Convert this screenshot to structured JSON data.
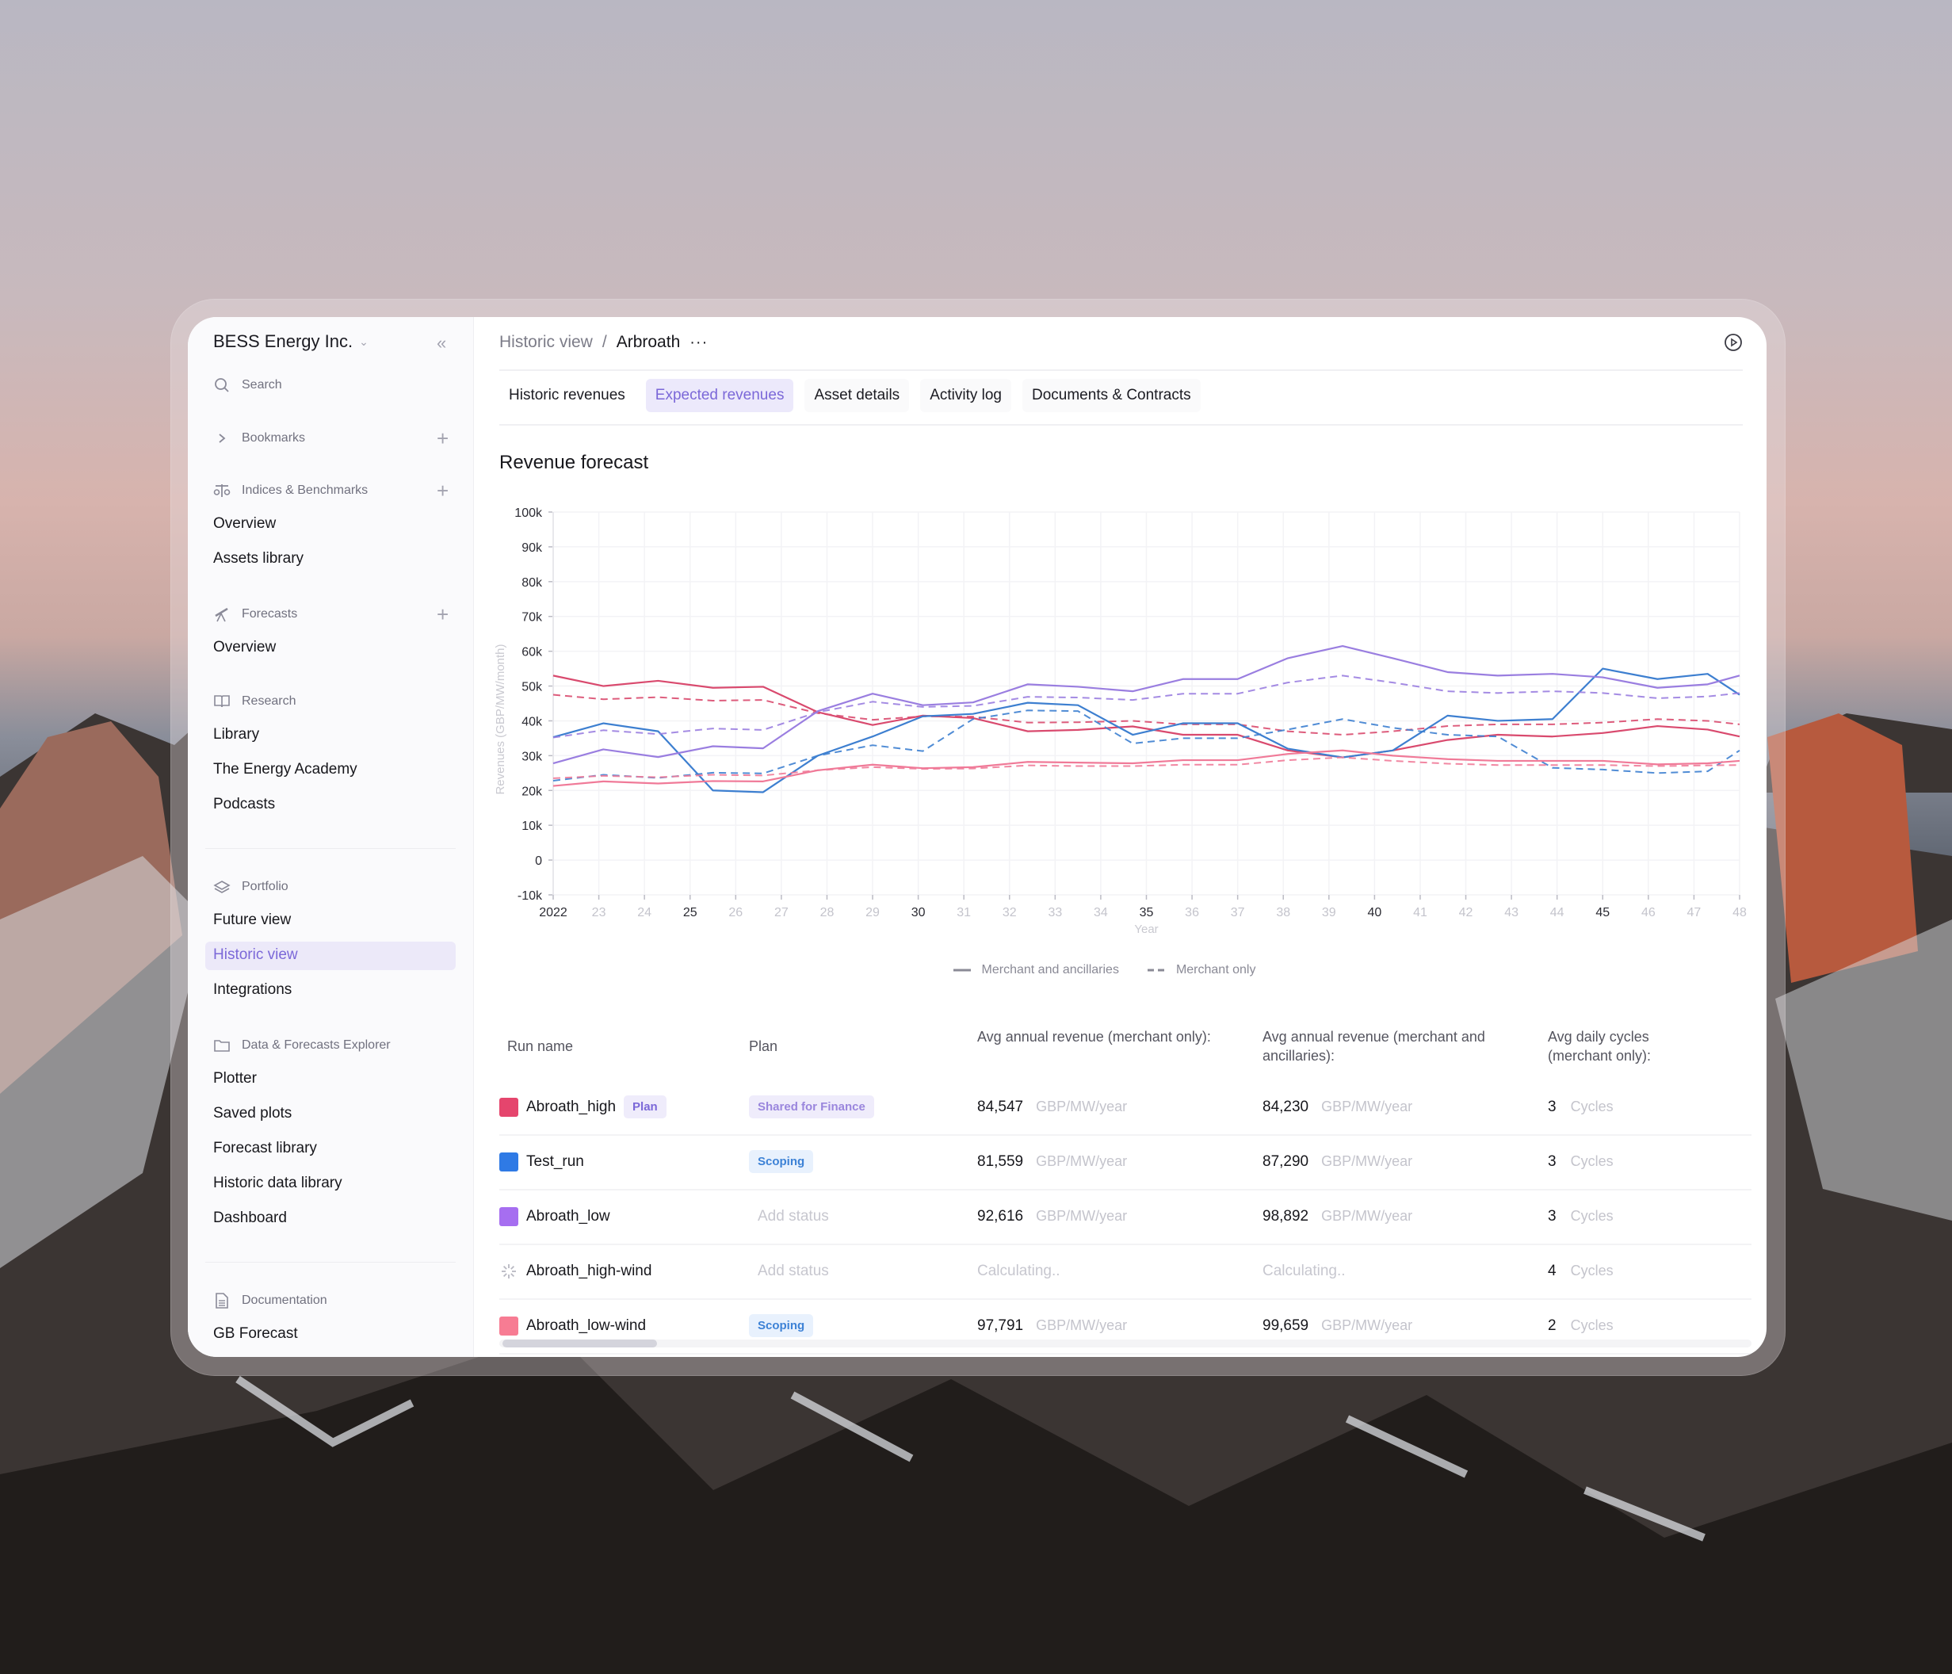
{
  "sidebar": {
    "org_name": "BESS Energy Inc.",
    "search_label": "Search",
    "sections": [
      {
        "title": "Bookmarks",
        "icon": "chevron-right-icon",
        "has_add": true,
        "items": []
      },
      {
        "title": "Indices & Benchmarks",
        "icon": "scale-icon",
        "has_add": true,
        "items": [
          "Overview",
          "Assets library"
        ]
      },
      {
        "title": "Forecasts",
        "icon": "telescope-icon",
        "has_add": true,
        "items": [
          "Overview"
        ]
      },
      {
        "title": "Research",
        "icon": "book-icon",
        "has_add": false,
        "items": [
          "Library",
          "The Energy Academy",
          "Podcasts"
        ]
      },
      {
        "title": "Portfolio",
        "icon": "layers-icon",
        "has_add": false,
        "items": [
          "Future view",
          "Historic view",
          "Integrations"
        ]
      },
      {
        "title": "Data & Forecasts Explorer",
        "icon": "folder-icon",
        "has_add": false,
        "items": [
          "Plotter",
          "Saved plots",
          "Forecast library",
          "Historic data library",
          "Dashboard"
        ]
      },
      {
        "title": "Documentation",
        "icon": "document-icon",
        "has_add": false,
        "items": [
          "GB Forecast"
        ]
      }
    ],
    "active_item": "Historic view"
  },
  "header": {
    "breadcrumb": [
      "Historic view",
      "Arbroath"
    ],
    "breadcrumb_separator": "/",
    "more_label": "···"
  },
  "tabs": [
    {
      "label": "Historic revenues",
      "active": false
    },
    {
      "label": "Expected revenues",
      "active": true
    },
    {
      "label": "Asset details",
      "active": false
    },
    {
      "label": "Activity log",
      "active": false
    },
    {
      "label": "Documents & Contracts",
      "active": false
    }
  ],
  "chart_section": {
    "title": "Revenue forecast"
  },
  "colors": {
    "accent": "#7b68d8",
    "abroath_high": "#d94a6e",
    "test_run": "#3d7fd0",
    "abroath_low": "#9a7ee0",
    "abroath_low_wind": "#f07a98"
  },
  "chart_data": {
    "type": "line",
    "title": "Revenue forecast",
    "xlabel": "Year",
    "ylabel": "Revenues (GBP/MW/month)",
    "ylim": [
      -10000,
      100000
    ],
    "xlim": [
      2022,
      2048
    ],
    "yticks": [
      "100k",
      "90k",
      "80k",
      "70k",
      "60k",
      "50k",
      "40k",
      "30k",
      "20k",
      "10k",
      "0",
      "-10k"
    ],
    "ytick_values": [
      100000,
      90000,
      80000,
      70000,
      60000,
      50000,
      40000,
      30000,
      20000,
      10000,
      0,
      -10000
    ],
    "xticks": [
      "2022",
      "23",
      "24",
      "25",
      "26",
      "27",
      "28",
      "29",
      "30",
      "31",
      "32",
      "33",
      "34",
      "35",
      "36",
      "37",
      "38",
      "39",
      "40",
      "41",
      "42",
      "43",
      "44",
      "45",
      "46",
      "47",
      "48"
    ],
    "xtick_emphasis": [
      "2022",
      "25",
      "30",
      "35",
      "40",
      "45"
    ],
    "grid": true,
    "legend": {
      "placement": "bottom",
      "entries": [
        {
          "label": "Merchant and ancillaries",
          "style": "solid"
        },
        {
          "label": "Merchant only",
          "style": "dashed"
        }
      ]
    },
    "x": [
      2022,
      2023.1,
      2024.3,
      2025.5,
      2026.6,
      2027.8,
      2029,
      2030.1,
      2031.2,
      2032.4,
      2033.5,
      2034.7,
      2035.8,
      2037,
      2038.1,
      2039.3,
      2040.4,
      2041.6,
      2042.7,
      2043.9,
      2045,
      2046.2,
      2047.3,
      2048.5
    ],
    "series": [
      {
        "name": "Abroath_high – Merchant and ancillaries",
        "style": "solid",
        "color": "#d94a6e",
        "values": [
          53000,
          50000,
          51500,
          49500,
          49800,
          42500,
          38800,
          41500,
          40800,
          37000,
          37400,
          38400,
          36000,
          36000,
          31500,
          29500,
          31500,
          34500,
          36000,
          35500,
          36500,
          38500,
          37500,
          35500
        ]
      },
      {
        "name": "Abroath_high – Merchant only",
        "style": "dashed",
        "color": "#d94a6e",
        "values": [
          47500,
          46200,
          46800,
          45800,
          46000,
          42200,
          40300,
          41300,
          41200,
          39500,
          39600,
          40000,
          39000,
          39000,
          37000,
          36000,
          37000,
          38500,
          39000,
          39000,
          39500,
          40500,
          40000,
          39000
        ]
      },
      {
        "name": "Test_run – Merchant and ancillaries",
        "style": "solid",
        "color": "#3d7fd0",
        "values": [
          35300,
          39300,
          37000,
          20000,
          19500,
          30000,
          35500,
          41300,
          42000,
          45200,
          44500,
          36000,
          39300,
          39300,
          32000,
          29500,
          31500,
          41500,
          40000,
          40500,
          55000,
          52000,
          53500,
          47500
        ]
      },
      {
        "name": "Test_run – Merchant only",
        "style": "dashed",
        "color": "#3d7fd0",
        "values": [
          22800,
          24500,
          23600,
          25100,
          24900,
          30000,
          33000,
          31300,
          40500,
          43000,
          42800,
          33500,
          35000,
          35000,
          37500,
          40500,
          38000,
          36000,
          35500,
          26500,
          26000,
          25000,
          25500,
          31500
        ]
      },
      {
        "name": "Abroath_low – Merchant and ancillaries",
        "style": "solid",
        "color": "#9a7ee0",
        "values": [
          27800,
          31800,
          29600,
          32700,
          32100,
          42800,
          47800,
          44500,
          45300,
          50500,
          49800,
          48500,
          52000,
          52000,
          58000,
          61500,
          58000,
          54000,
          53000,
          53500,
          52500,
          49500,
          50500,
          53000
        ]
      },
      {
        "name": "Abroath_low – Merchant only",
        "style": "dashed",
        "color": "#9a7ee0",
        "values": [
          35200,
          37300,
          36200,
          37800,
          37400,
          42500,
          45500,
          44000,
          44300,
          46900,
          46700,
          46000,
          47800,
          47800,
          51000,
          53000,
          51000,
          48500,
          48000,
          48500,
          48000,
          46500,
          47000,
          48000
        ]
      },
      {
        "name": "Abroath_low-wind – Merchant and ancillaries",
        "style": "solid",
        "color": "#f07a98",
        "values": [
          21300,
          22600,
          22000,
          22700,
          22600,
          25800,
          27400,
          26400,
          26700,
          28200,
          28000,
          27800,
          28700,
          28700,
          30500,
          31500,
          30000,
          29000,
          28500,
          28500,
          28500,
          27500,
          27800,
          28500
        ]
      },
      {
        "name": "Abroath_low-wind – Merchant only",
        "style": "dashed",
        "color": "#f07a98",
        "values": [
          23500,
          24200,
          23800,
          24500,
          24300,
          25800,
          26700,
          26200,
          26300,
          27200,
          27000,
          27000,
          27400,
          27400,
          28700,
          29500,
          28500,
          27700,
          27300,
          27300,
          27300,
          27000,
          27200,
          27300
        ]
      }
    ]
  },
  "table": {
    "columns": [
      "Run name",
      "Plan",
      "Avg annual revenue (merchant only):",
      "Avg annual revenue (merchant and ancillaries):",
      "Avg daily cycles (merchant only):"
    ],
    "rows": [
      {
        "name": "Abroath_high",
        "swatch": "#e5456d",
        "tag": "Plan",
        "plan": "Shared for Finance",
        "plan_style": "fin",
        "rev_merchant": "84,547",
        "rev_unit": "GBP/MW/year",
        "rev_anc": "84,230",
        "cycles": "3",
        "cycles_unit": "Cycles",
        "loading": false
      },
      {
        "name": "Test_run",
        "swatch": "#2f7ae5",
        "tag": "",
        "plan": "Scoping",
        "plan_style": "scope",
        "rev_merchant": "81,559",
        "rev_unit": "GBP/MW/year",
        "rev_anc": "87,290",
        "cycles": "3",
        "cycles_unit": "Cycles",
        "loading": false
      },
      {
        "name": "Abroath_low",
        "swatch": "#a66ef0",
        "tag": "",
        "plan": "Add status",
        "plan_style": "empty",
        "rev_merchant": "92,616",
        "rev_unit": "GBP/MW/year",
        "rev_anc": "98,892",
        "cycles": "3",
        "cycles_unit": "Cycles",
        "loading": false
      },
      {
        "name": "Abroath_high-wind",
        "swatch": "",
        "tag": "",
        "plan": "Add status",
        "plan_style": "empty",
        "rev_merchant": "Calculating..",
        "rev_unit": "",
        "rev_anc": "Calculating..",
        "cycles": "4",
        "cycles_unit": "Cycles",
        "loading": true
      },
      {
        "name": "Abroath_low-wind",
        "swatch": "#f77c93",
        "tag": "",
        "plan": "Scoping",
        "plan_style": "scope",
        "rev_merchant": "97,791",
        "rev_unit": "GBP/MW/year",
        "rev_anc": "99,659",
        "cycles": "2",
        "cycles_unit": "Cycles",
        "loading": false
      }
    ]
  }
}
